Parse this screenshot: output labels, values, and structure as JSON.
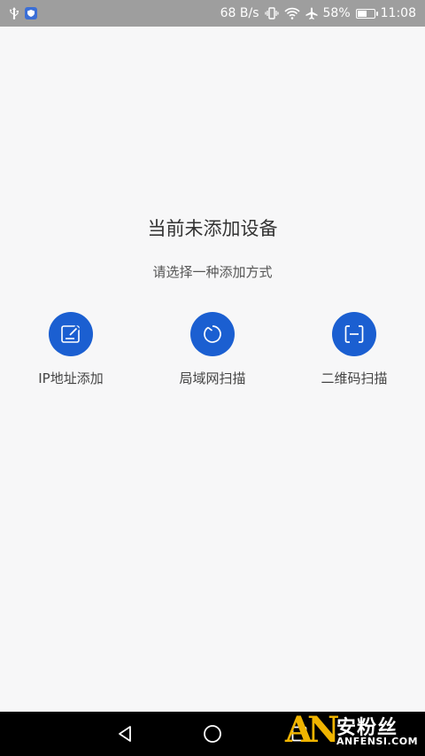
{
  "status_bar": {
    "net_speed": "68 B/s",
    "battery_percent": "58%",
    "battery_level": 0.58,
    "time": "11:08",
    "icons": [
      "usb-icon",
      "app-shield-icon",
      "vibrate-icon",
      "wifi-icon",
      "airplane-icon",
      "battery-icon"
    ]
  },
  "empty_state": {
    "title": "当前未添加设备",
    "subtitle": "请选择一种添加方式"
  },
  "options": [
    {
      "label": "IP地址添加",
      "icon": "edit-note-icon"
    },
    {
      "label": "局域网扫描",
      "icon": "refresh-scan-icon"
    },
    {
      "label": "二维码扫描",
      "icon": "qr-scan-icon"
    }
  ],
  "nav_bar": {
    "icons": [
      "back-icon",
      "home-icon",
      "recents-icon"
    ]
  },
  "watermark": {
    "logo_text": "AN",
    "cn_text": "安粉丝",
    "en_text": "ANFENSI.COM"
  },
  "colors": {
    "accent": "#1b5fd1",
    "status_bar": "#9e9e9e",
    "nav_bar": "#000000",
    "background": "#f7f7f8",
    "watermark": "#f0b400"
  }
}
